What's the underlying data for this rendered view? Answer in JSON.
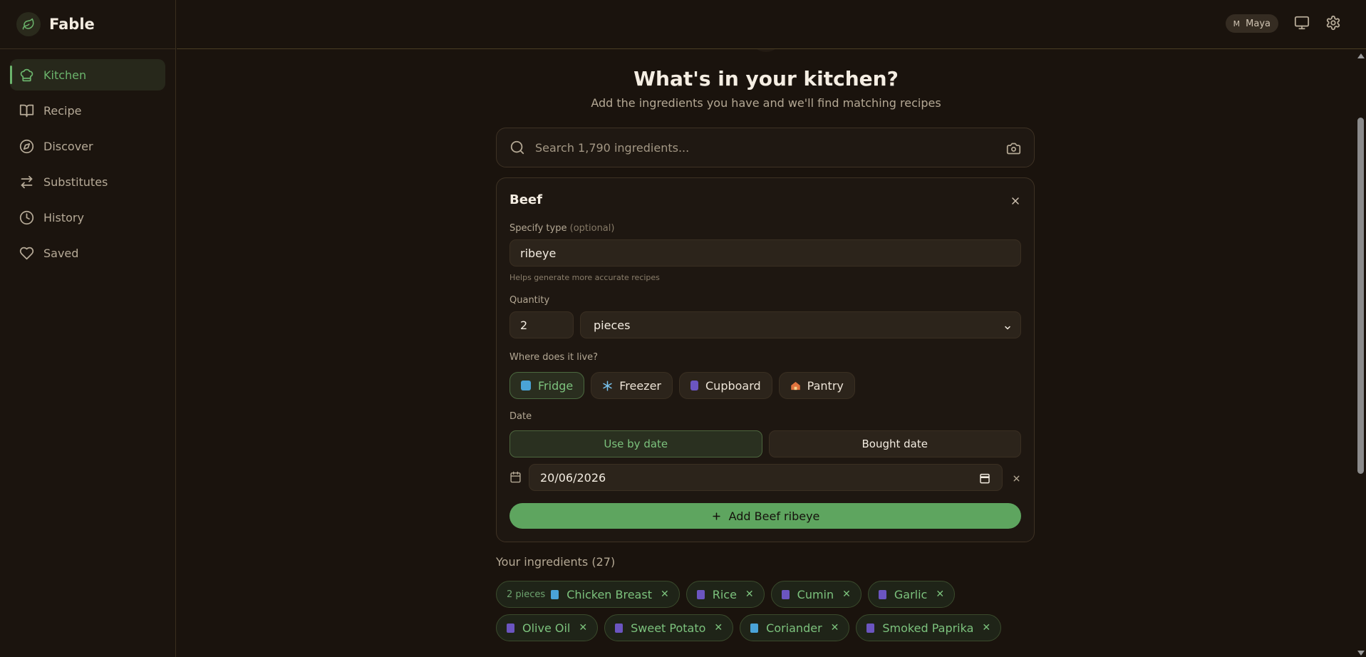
{
  "app": {
    "name": "Fable"
  },
  "sidebar": {
    "items": [
      {
        "label": "Kitchen",
        "icon": "chef-hat-icon",
        "active": true
      },
      {
        "label": "Recipe",
        "icon": "book-icon",
        "active": false
      },
      {
        "label": "Discover",
        "icon": "compass-icon",
        "active": false
      },
      {
        "label": "Substitutes",
        "icon": "swap-icon",
        "active": false
      },
      {
        "label": "History",
        "icon": "clock-icon",
        "active": false
      },
      {
        "label": "Saved",
        "icon": "heart-icon",
        "active": false
      }
    ]
  },
  "header": {
    "user_initial": "M",
    "user_name": "Maya",
    "icons": [
      "monitor-icon",
      "gear-icon"
    ]
  },
  "main": {
    "title": "What's in your kitchen?",
    "subtitle": "Add the ingredients you have and we'll find matching recipes",
    "search": {
      "placeholder": "Search 1,790 ingredients...",
      "value": ""
    }
  },
  "card": {
    "title": "Beef",
    "type_label": "Specify type",
    "type_optional": "(optional)",
    "type_value": "ribeye",
    "type_hint": "Helps generate more accurate recipes",
    "quantity_label": "Quantity",
    "quantity_value": "2",
    "unit_value": "pieces",
    "location_label": "Where does it live?",
    "locations": [
      {
        "label": "Fridge",
        "icon": "ice-cube-icon",
        "active": true
      },
      {
        "label": "Freezer",
        "icon": "snowflake-icon",
        "active": false
      },
      {
        "label": "Cupboard",
        "icon": "jar-icon",
        "active": false
      },
      {
        "label": "Pantry",
        "icon": "house-icon",
        "active": false
      }
    ],
    "date_label": "Date",
    "date_options": [
      {
        "label": "Use by date",
        "active": true
      },
      {
        "label": "Bought date",
        "active": false
      }
    ],
    "date_value": "20/06/2026",
    "add_button": "Add Beef ribeye"
  },
  "ingredients": {
    "heading": "Your ingredients (27)",
    "rows": [
      [
        {
          "qty": "2 pieces",
          "name": "Chicken Breast",
          "icon": "ice-cube-icon"
        },
        {
          "qty": "",
          "name": "Rice",
          "icon": "jar-icon"
        },
        {
          "qty": "",
          "name": "Cumin",
          "icon": "jar-icon"
        },
        {
          "qty": "",
          "name": "Garlic",
          "icon": "jar-icon"
        }
      ],
      [
        {
          "qty": "",
          "name": "Olive Oil",
          "icon": "jar-icon"
        },
        {
          "qty": "",
          "name": "Sweet Potato",
          "icon": "jar-icon"
        },
        {
          "qty": "",
          "name": "Coriander",
          "icon": "ice-cube-icon"
        },
        {
          "qty": "",
          "name": "Smoked Paprika",
          "icon": "jar-icon"
        }
      ]
    ]
  },
  "colors": {
    "accent": "#6bb46c",
    "background": "#1a130d",
    "button": "#5ea55f"
  }
}
